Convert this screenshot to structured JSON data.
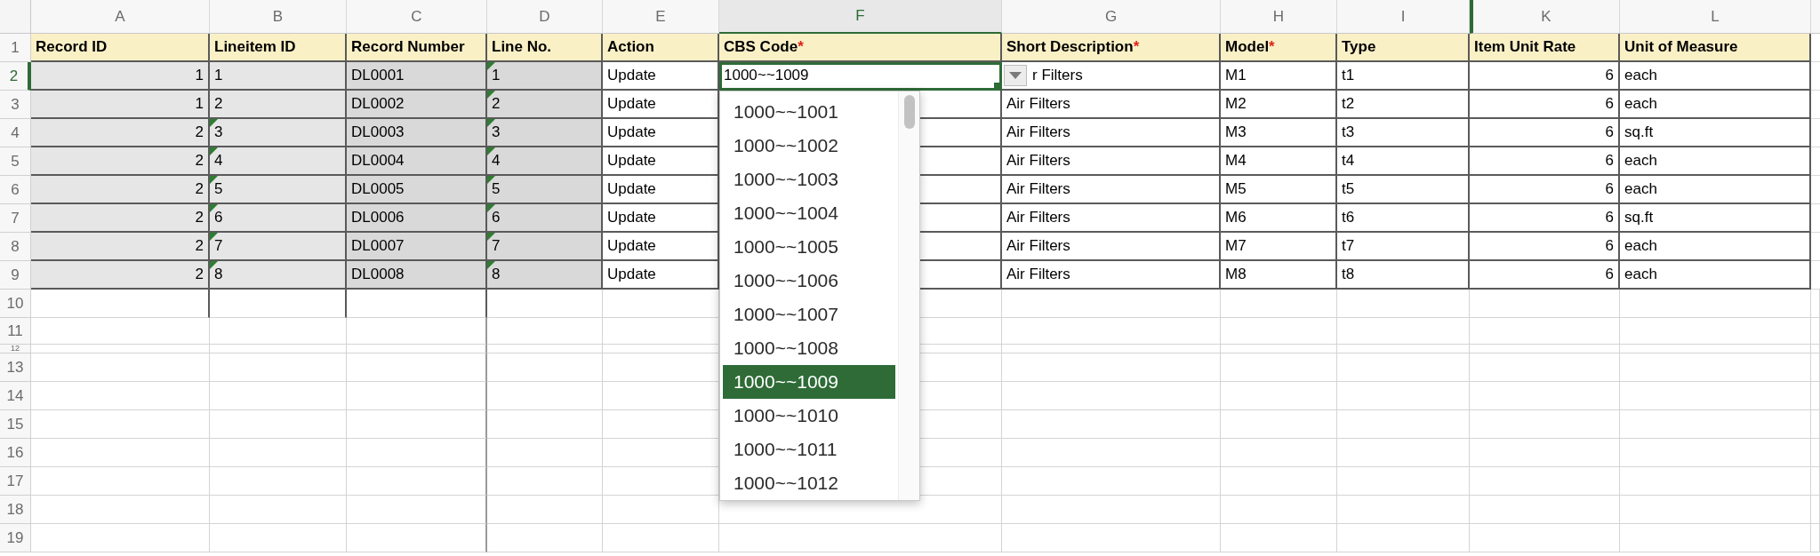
{
  "columns": [
    {
      "letter": "A",
      "header": "Record ID",
      "kind": "number",
      "locked": true,
      "selected": false
    },
    {
      "letter": "B",
      "header": "Lineitem ID",
      "kind": "text",
      "locked": true,
      "selected": false
    },
    {
      "letter": "C",
      "header": "Record Number",
      "kind": "text",
      "locked": true,
      "selected": false
    },
    {
      "letter": "D",
      "header": "Line No.",
      "kind": "text",
      "locked": true,
      "selected": false
    },
    {
      "letter": "E",
      "header": "Action",
      "kind": "text",
      "locked": false,
      "selected": false
    },
    {
      "letter": "F",
      "header": "CBS Code",
      "required_mark": "*",
      "kind": "text",
      "locked": false,
      "selected": true
    },
    {
      "letter": "G",
      "header": "Short Description",
      "required_mark": "*",
      "kind": "text",
      "locked": false,
      "selected": false
    },
    {
      "letter": "H",
      "header": "Model",
      "required_mark": "*",
      "kind": "text",
      "locked": false,
      "selected": false
    },
    {
      "letter": "I",
      "header": "Type",
      "kind": "text",
      "locked": false,
      "selected": false
    },
    {
      "letter": "K",
      "header": "Item Unit Rate",
      "kind": "number",
      "locked": false,
      "selected": false
    },
    {
      "letter": "L",
      "header": "Unit of Measure",
      "kind": "text",
      "locked": false,
      "selected": false
    }
  ],
  "header_row_number": "1",
  "rows": [
    {
      "number": "2",
      "selected": true,
      "flags": [
        false,
        false,
        false,
        true,
        false,
        false,
        false,
        false,
        false,
        false,
        false
      ],
      "cells": [
        "1",
        "1",
        "DL0001",
        "1",
        "Update",
        "1000~~1009",
        "r Filters",
        "M1",
        "t1",
        "6",
        "each"
      ]
    },
    {
      "number": "3",
      "selected": false,
      "flags": [
        false,
        false,
        false,
        true,
        false,
        false,
        false,
        false,
        false,
        false,
        false
      ],
      "cells": [
        "1",
        "2",
        "DL0002",
        "2",
        "Update",
        "",
        "Air Filters",
        "M2",
        "t2",
        "6",
        "each"
      ]
    },
    {
      "number": "4",
      "selected": false,
      "flags": [
        false,
        true,
        false,
        true,
        false,
        false,
        false,
        false,
        false,
        false,
        false
      ],
      "cells": [
        "2",
        "3",
        "DL0003",
        "3",
        "Update",
        "",
        "Air Filters",
        "M3",
        "t3",
        "6",
        "sq.ft"
      ]
    },
    {
      "number": "5",
      "selected": false,
      "flags": [
        false,
        true,
        false,
        true,
        false,
        false,
        false,
        false,
        false,
        false,
        false
      ],
      "cells": [
        "2",
        "4",
        "DL0004",
        "4",
        "Update",
        "",
        "Air Filters",
        "M4",
        "t4",
        "6",
        "each"
      ]
    },
    {
      "number": "6",
      "selected": false,
      "flags": [
        false,
        true,
        false,
        true,
        false,
        false,
        false,
        false,
        false,
        false,
        false
      ],
      "cells": [
        "2",
        "5",
        "DL0005",
        "5",
        "Update",
        "",
        "Air Filters",
        "M5",
        "t5",
        "6",
        "each"
      ]
    },
    {
      "number": "7",
      "selected": false,
      "flags": [
        false,
        true,
        false,
        true,
        false,
        false,
        false,
        false,
        false,
        false,
        false
      ],
      "cells": [
        "2",
        "6",
        "DL0006",
        "6",
        "Update",
        "",
        "Air Filters",
        "M6",
        "t6",
        "6",
        "sq.ft"
      ]
    },
    {
      "number": "8",
      "selected": false,
      "flags": [
        false,
        true,
        false,
        true,
        false,
        false,
        false,
        false,
        false,
        false,
        false
      ],
      "cells": [
        "2",
        "7",
        "DL0007",
        "7",
        "Update",
        "",
        "Air Filters",
        "M7",
        "t7",
        "6",
        "each"
      ]
    },
    {
      "number": "9",
      "selected": false,
      "flags": [
        false,
        true,
        false,
        true,
        false,
        false,
        false,
        false,
        false,
        false,
        false
      ],
      "cells": [
        "2",
        "8",
        "DL0008",
        "8",
        "Update",
        "",
        "Air Filters",
        "M8",
        "t8",
        "6",
        "each"
      ]
    }
  ],
  "empty_rows": [
    "10",
    "11",
    "12",
    "13",
    "14",
    "15",
    "16",
    "17",
    "18",
    "19"
  ],
  "dropdown": {
    "items": [
      {
        "label": "1000~~1001",
        "selected": false
      },
      {
        "label": "1000~~1002",
        "selected": false
      },
      {
        "label": "1000~~1003",
        "selected": false
      },
      {
        "label": "1000~~1004",
        "selected": false
      },
      {
        "label": "1000~~1005",
        "selected": false
      },
      {
        "label": "1000~~1006",
        "selected": false
      },
      {
        "label": "1000~~1007",
        "selected": false
      },
      {
        "label": "1000~~1008",
        "selected": false
      },
      {
        "label": "1000~~1009",
        "selected": true
      },
      {
        "label": "1000~~1010",
        "selected": false
      },
      {
        "label": "1000~~1011",
        "selected": false
      },
      {
        "label": "1000~~1012",
        "selected": false
      }
    ]
  }
}
